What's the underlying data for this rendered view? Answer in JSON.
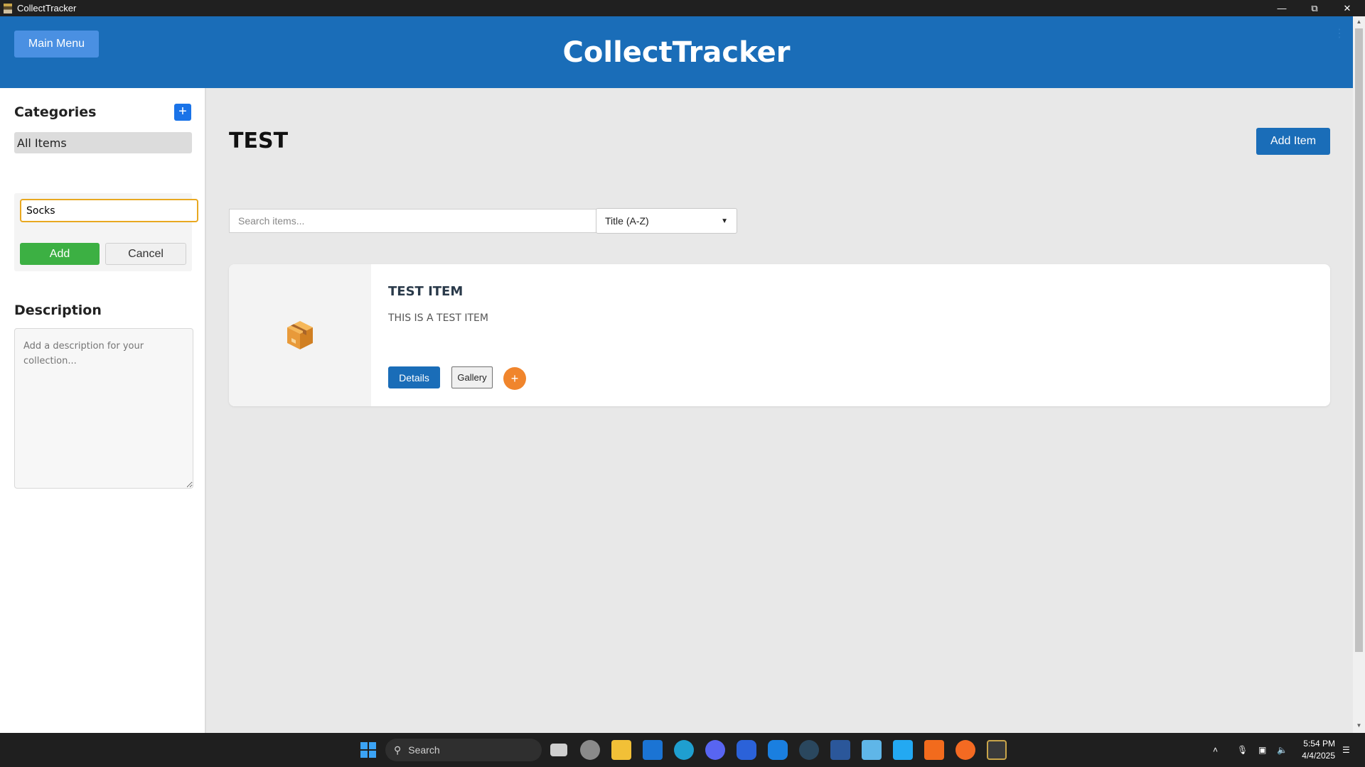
{
  "window": {
    "title": "CollectTracker"
  },
  "header": {
    "main_menu_label": "Main Menu",
    "app_title": "CollectTracker",
    "dots": "⋮"
  },
  "sidebar": {
    "categories_heading": "Categories",
    "add_category_symbol": "+",
    "all_items_label": "All Items",
    "new_category_value": "Socks",
    "add_label": "Add",
    "cancel_label": "Cancel",
    "description_heading": "Description",
    "description_placeholder": "Add a description for your collection..."
  },
  "main": {
    "collection_title": "TEST",
    "add_item_label": "Add Item",
    "search_placeholder": "Search items...",
    "sort_value": "Title (A-Z)",
    "items": [
      {
        "title": "TEST ITEM",
        "description": "THIS IS A TEST ITEM",
        "details_label": "Details",
        "gallery_label": "Gallery",
        "plus_symbol": "+",
        "thumb_icon": "box-icon"
      }
    ]
  },
  "taskbar": {
    "search_label": "Search",
    "time": "5:54 PM",
    "date": "4/4/2025"
  },
  "colors": {
    "header": "#1a6db8",
    "accent_orange": "#f0852c",
    "add_green": "#3cb043",
    "input_focus": "#e8a820"
  }
}
